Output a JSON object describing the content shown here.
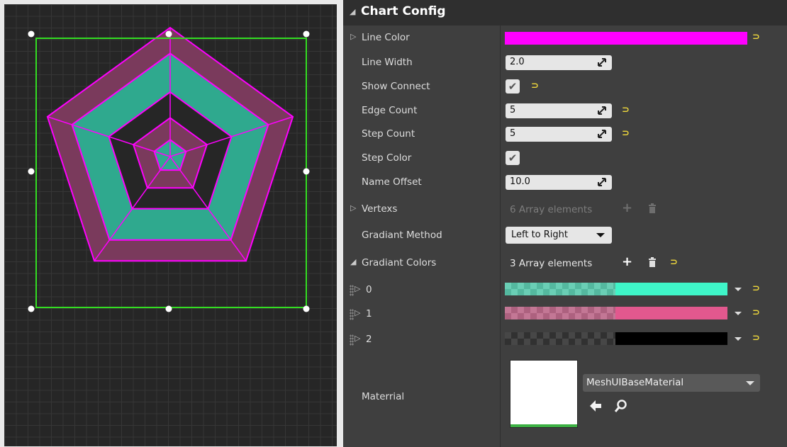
{
  "viewport": {
    "chart": {
      "edge_count": 5,
      "rings": [
        1.0,
        0.8,
        0.5,
        0.3,
        0.13
      ],
      "line_color": "#ff00ff",
      "band_colors": [
        "#7a3a5c",
        "#2fa98e",
        "#262626",
        "#7a3a5c",
        "#2fa98e"
      ]
    },
    "selection_color": "#33dd22"
  },
  "panel": {
    "section_title": "Chart Config",
    "line_color": {
      "label": "Line Color",
      "value": "#ff00ff"
    },
    "line_width": {
      "label": "Line Width",
      "value": "2.0"
    },
    "show_connect": {
      "label": "Show Connect",
      "checked": true
    },
    "edge_count": {
      "label": "Edge Count",
      "value": "5"
    },
    "step_count": {
      "label": "Step Count",
      "value": "5"
    },
    "step_color": {
      "label": "Step Color",
      "checked": true
    },
    "name_offset": {
      "label": "Name Offset",
      "value": "10.0"
    },
    "vertexs": {
      "label": "Vertexs",
      "info": "6 Array elements"
    },
    "gradiant_method": {
      "label": "Gradiant Method",
      "value": "Left to Right"
    },
    "gradiant_colors": {
      "label": "Gradiant Colors",
      "info": "3 Array elements",
      "items": [
        {
          "index": "0",
          "color": "#3ff5c8"
        },
        {
          "index": "1",
          "color": "#e2588e"
        },
        {
          "index": "2",
          "color": "#000000"
        }
      ]
    },
    "material": {
      "label": "Materrial",
      "value": "MeshUIBaseMaterial"
    }
  }
}
